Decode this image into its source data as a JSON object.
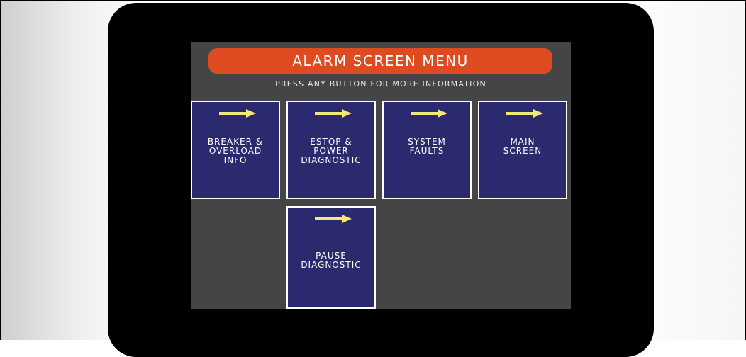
{
  "header": {
    "title": "ALARM SCREEN MENU",
    "subtitle": "PRESS ANY BUTTON FOR MORE INFORMATION"
  },
  "buttons": [
    {
      "label": "BREAKER &\nOVERLOAD\nINFO",
      "icon": "right-arrow-icon"
    },
    {
      "label": "ESTOP &\nPOWER\nDIAGNOSTIC",
      "icon": "right-arrow-icon"
    },
    {
      "label": "SYSTEM\nFAULTS",
      "icon": "right-arrow-icon"
    },
    {
      "label": "MAIN\nSCREEN",
      "icon": "right-arrow-icon"
    },
    {
      "label": "PAUSE\nDIAGNOSTIC",
      "icon": "right-arrow-icon"
    }
  ],
  "colors": {
    "title_bar": "#de4b21",
    "screen_bg": "#454545",
    "tile_bg": "#2c2a6e",
    "tile_border": "#ffffff",
    "arrow": "#f5e87a"
  }
}
